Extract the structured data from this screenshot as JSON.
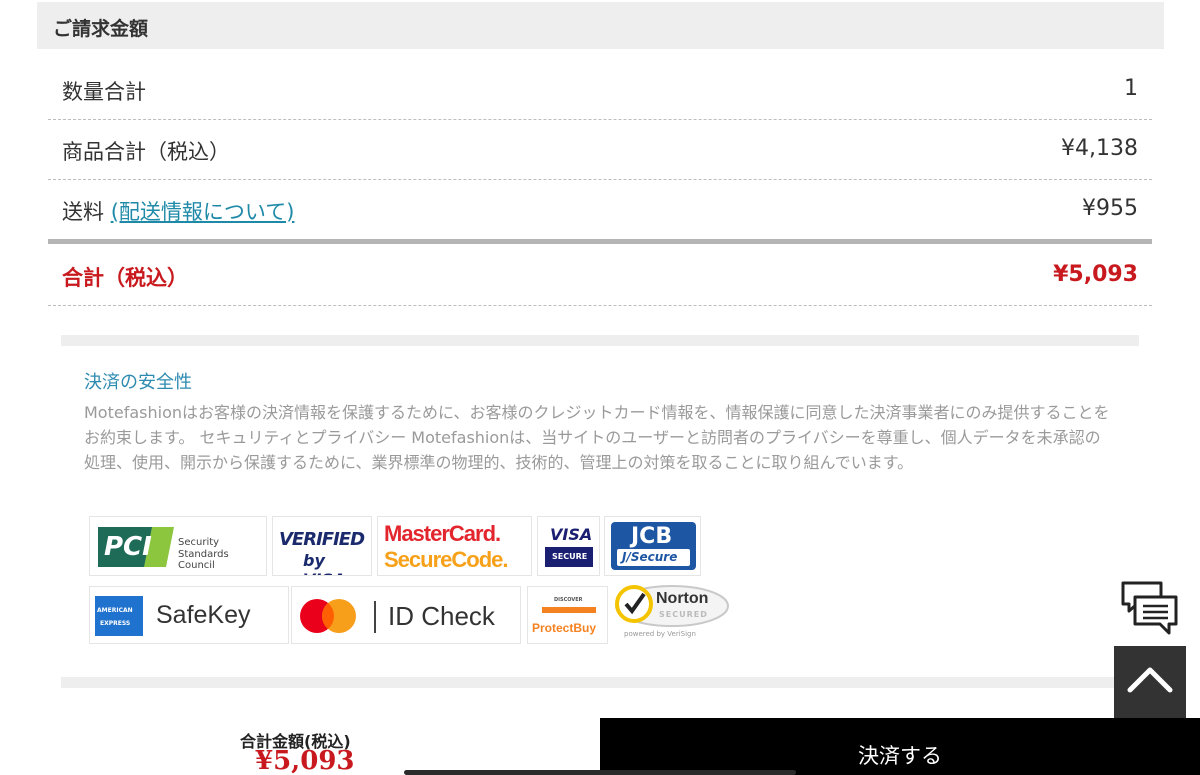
{
  "header": {
    "title": "ご請求金額"
  },
  "summary": {
    "quantity": {
      "label": "数量合計",
      "value": "1"
    },
    "subtotal": {
      "label": "商品合計（税込）",
      "value": "¥4,138"
    },
    "shipping": {
      "label": "送料",
      "link": "(配送情報について)",
      "value": "¥955"
    },
    "total": {
      "label": "合計（税込）",
      "value": "¥5,093"
    }
  },
  "security": {
    "title": "決済の安全性",
    "text": "Motefashionはお客様の決済情報を保護するために、お客様のクレジットカード情報を、情報保護に同意した決済事業者にのみ提供することをお約束します。 セキュリティとプライバシー Motefashionは、当サイトのユーザーと訪問者のプライバシーを尊重し、個人データを未承認の処理、使用、開示から保護するために、業界標準の物理的、技術的、管理上の対策を取ることに取り組んでいます。"
  },
  "logos": {
    "pci": {
      "mark": "PCI",
      "line1": "Security",
      "line2": "Standards Council"
    },
    "vbv": {
      "line1": "VERIFIED",
      "line2": "by VISA"
    },
    "msc": {
      "line1": "MasterCard.",
      "line2": "SecureCode."
    },
    "visa": {
      "line1": "VISA",
      "line2": "SECURE"
    },
    "jcb": {
      "line1": "JCB",
      "line2": "J/Secure"
    },
    "safekey": {
      "badge1": "AMERICAN",
      "badge2": "EXPRESS",
      "text": "SafeKey"
    },
    "idcheck": {
      "text": "ID Check"
    },
    "protectbuy": {
      "line1": "DISCOVER",
      "line2": "ProtectBuy"
    },
    "norton": {
      "line1": "Norton",
      "line2": "SECURED",
      "line3": "powered by VeriSign"
    }
  },
  "footer": {
    "total_label": "合計金額(税込)",
    "total_value": "¥5,093",
    "pay_button": "決済する"
  },
  "colors": {
    "accent_red": "#c8191e",
    "link_blue": "#1f8aa8",
    "title_blue": "#2e8bb0"
  }
}
